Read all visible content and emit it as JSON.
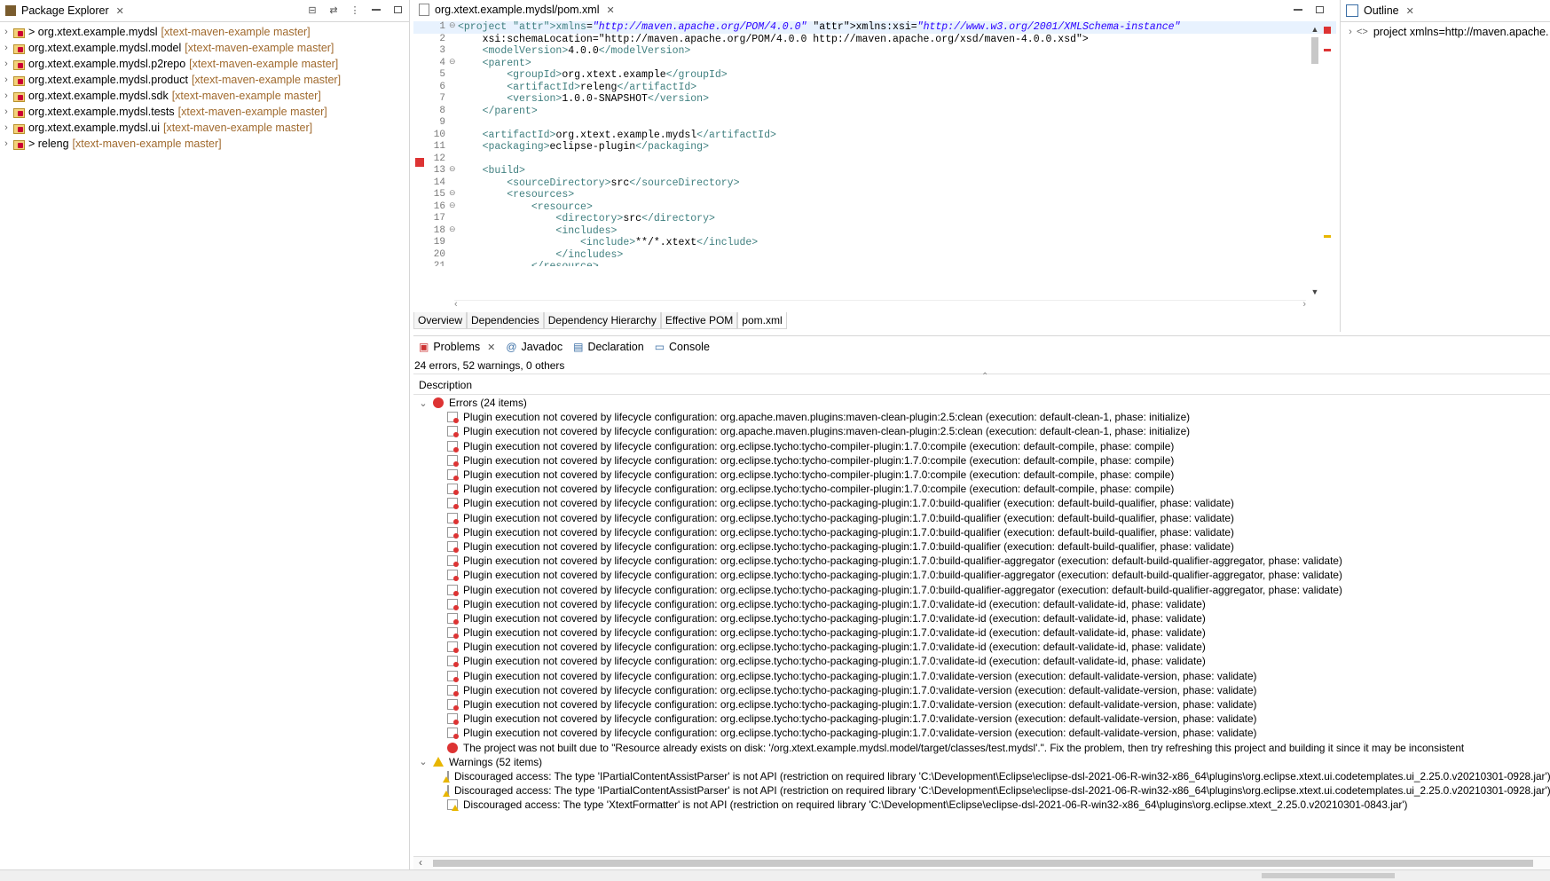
{
  "package_explorer": {
    "title": "Package Explorer",
    "projects": [
      {
        "name": "> org.xtext.example.mydsl",
        "branch": "[xtext-maven-example master]"
      },
      {
        "name": "org.xtext.example.mydsl.model",
        "branch": "[xtext-maven-example master]"
      },
      {
        "name": "org.xtext.example.mydsl.p2repo",
        "branch": "[xtext-maven-example master]"
      },
      {
        "name": "org.xtext.example.mydsl.product",
        "branch": "[xtext-maven-example master]"
      },
      {
        "name": "org.xtext.example.mydsl.sdk",
        "branch": "[xtext-maven-example master]"
      },
      {
        "name": "org.xtext.example.mydsl.tests",
        "branch": "[xtext-maven-example master]"
      },
      {
        "name": "org.xtext.example.mydsl.ui",
        "branch": "[xtext-maven-example master]"
      },
      {
        "name": "> releng",
        "branch": "[xtext-maven-example master]"
      }
    ]
  },
  "editor": {
    "tab_title": "org.xtext.example.mydsl/pom.xml",
    "lines": [
      {
        "n": "1",
        "f": "⊖",
        "c": "<project xmlns=\"http://maven.apache.org/POM/4.0.0\" xmlns:xsi=\"http://www.w3.org/2001/XMLSchema-instance\""
      },
      {
        "n": "2",
        "f": "",
        "c": "    xsi:schemaLocation=\"http://maven.apache.org/POM/4.0.0 http://maven.apache.org/xsd/maven-4.0.0.xsd\">"
      },
      {
        "n": "3",
        "f": "",
        "c": "    <modelVersion>4.0.0</modelVersion>"
      },
      {
        "n": "4",
        "f": "⊖",
        "c": "    <parent>"
      },
      {
        "n": "5",
        "f": "",
        "c": "        <groupId>org.xtext.example</groupId>"
      },
      {
        "n": "6",
        "f": "",
        "c": "        <artifactId>releng</artifactId>"
      },
      {
        "n": "7",
        "f": "",
        "c": "        <version>1.0.0-SNAPSHOT</version>"
      },
      {
        "n": "8",
        "f": "",
        "c": "    </parent>"
      },
      {
        "n": "9",
        "f": "",
        "c": ""
      },
      {
        "n": "10",
        "f": "",
        "c": "    <artifactId>org.xtext.example.mydsl</artifactId>"
      },
      {
        "n": "11",
        "f": "",
        "c": "    <packaging>eclipse-plugin</packaging>"
      },
      {
        "n": "12",
        "f": "",
        "c": ""
      },
      {
        "n": "13",
        "f": "⊖",
        "c": "    <build>"
      },
      {
        "n": "14",
        "f": "",
        "c": "        <sourceDirectory>src</sourceDirectory>"
      },
      {
        "n": "15",
        "f": "⊖",
        "c": "        <resources>"
      },
      {
        "n": "16",
        "f": "⊖",
        "c": "            <resource>"
      },
      {
        "n": "17",
        "f": "",
        "c": "                <directory>src</directory>"
      },
      {
        "n": "18",
        "f": "⊖",
        "c": "                <includes>"
      },
      {
        "n": "19",
        "f": "",
        "c": "                    <include>**/*.xtext</include>"
      },
      {
        "n": "20",
        "f": "",
        "c": "                </includes>"
      },
      {
        "n": "21",
        "f": "",
        "c": "            </resource>"
      }
    ],
    "bottom_tabs": [
      "Overview",
      "Dependencies",
      "Dependency Hierarchy",
      "Effective POM",
      "pom.xml"
    ]
  },
  "outline": {
    "title": "Outline",
    "item": "project xmlns=http://maven.apache."
  },
  "problems": {
    "tabs": [
      "Problems",
      "Javadoc",
      "Declaration",
      "Console"
    ],
    "summary": "24 errors, 52 warnings, 0 others",
    "column": "Description",
    "errors_header": "Errors (24 items)",
    "errors": [
      "Plugin execution not covered by lifecycle configuration: org.apache.maven.plugins:maven-clean-plugin:2.5:clean (execution: default-clean-1, phase: initialize)",
      "Plugin execution not covered by lifecycle configuration: org.apache.maven.plugins:maven-clean-plugin:2.5:clean (execution: default-clean-1, phase: initialize)",
      "Plugin execution not covered by lifecycle configuration: org.eclipse.tycho:tycho-compiler-plugin:1.7.0:compile (execution: default-compile, phase: compile)",
      "Plugin execution not covered by lifecycle configuration: org.eclipse.tycho:tycho-compiler-plugin:1.7.0:compile (execution: default-compile, phase: compile)",
      "Plugin execution not covered by lifecycle configuration: org.eclipse.tycho:tycho-compiler-plugin:1.7.0:compile (execution: default-compile, phase: compile)",
      "Plugin execution not covered by lifecycle configuration: org.eclipse.tycho:tycho-compiler-plugin:1.7.0:compile (execution: default-compile, phase: compile)",
      "Plugin execution not covered by lifecycle configuration: org.eclipse.tycho:tycho-packaging-plugin:1.7.0:build-qualifier (execution: default-build-qualifier, phase: validate)",
      "Plugin execution not covered by lifecycle configuration: org.eclipse.tycho:tycho-packaging-plugin:1.7.0:build-qualifier (execution: default-build-qualifier, phase: validate)",
      "Plugin execution not covered by lifecycle configuration: org.eclipse.tycho:tycho-packaging-plugin:1.7.0:build-qualifier (execution: default-build-qualifier, phase: validate)",
      "Plugin execution not covered by lifecycle configuration: org.eclipse.tycho:tycho-packaging-plugin:1.7.0:build-qualifier (execution: default-build-qualifier, phase: validate)",
      "Plugin execution not covered by lifecycle configuration: org.eclipse.tycho:tycho-packaging-plugin:1.7.0:build-qualifier-aggregator (execution: default-build-qualifier-aggregator, phase: validate)",
      "Plugin execution not covered by lifecycle configuration: org.eclipse.tycho:tycho-packaging-plugin:1.7.0:build-qualifier-aggregator (execution: default-build-qualifier-aggregator, phase: validate)",
      "Plugin execution not covered by lifecycle configuration: org.eclipse.tycho:tycho-packaging-plugin:1.7.0:build-qualifier-aggregator (execution: default-build-qualifier-aggregator, phase: validate)",
      "Plugin execution not covered by lifecycle configuration: org.eclipse.tycho:tycho-packaging-plugin:1.7.0:validate-id (execution: default-validate-id, phase: validate)",
      "Plugin execution not covered by lifecycle configuration: org.eclipse.tycho:tycho-packaging-plugin:1.7.0:validate-id (execution: default-validate-id, phase: validate)",
      "Plugin execution not covered by lifecycle configuration: org.eclipse.tycho:tycho-packaging-plugin:1.7.0:validate-id (execution: default-validate-id, phase: validate)",
      "Plugin execution not covered by lifecycle configuration: org.eclipse.tycho:tycho-packaging-plugin:1.7.0:validate-id (execution: default-validate-id, phase: validate)",
      "Plugin execution not covered by lifecycle configuration: org.eclipse.tycho:tycho-packaging-plugin:1.7.0:validate-id (execution: default-validate-id, phase: validate)",
      "Plugin execution not covered by lifecycle configuration: org.eclipse.tycho:tycho-packaging-plugin:1.7.0:validate-version (execution: default-validate-version, phase: validate)",
      "Plugin execution not covered by lifecycle configuration: org.eclipse.tycho:tycho-packaging-plugin:1.7.0:validate-version (execution: default-validate-version, phase: validate)",
      "Plugin execution not covered by lifecycle configuration: org.eclipse.tycho:tycho-packaging-plugin:1.7.0:validate-version (execution: default-validate-version, phase: validate)",
      "Plugin execution not covered by lifecycle configuration: org.eclipse.tycho:tycho-packaging-plugin:1.7.0:validate-version (execution: default-validate-version, phase: validate)",
      "Plugin execution not covered by lifecycle configuration: org.eclipse.tycho:tycho-packaging-plugin:1.7.0:validate-version (execution: default-validate-version, phase: validate)"
    ],
    "error_last": "The project was not built due to \"Resource already exists on disk: '/org.xtext.example.mydsl.model/target/classes/test.mydsl'.\". Fix the problem, then try refreshing this project and building it since it may be inconsistent",
    "warnings_header": "Warnings (52 items)",
    "warnings": [
      "Discouraged access: The type 'IPartialContentAssistParser' is not API (restriction on required library 'C:\\Development\\Eclipse\\eclipse-dsl-2021-06-R-win32-x86_64\\plugins\\org.eclipse.xtext.ui.codetemplates.ui_2.25.0.v20210301-0928.jar')",
      "Discouraged access: The type 'IPartialContentAssistParser' is not API (restriction on required library 'C:\\Development\\Eclipse\\eclipse-dsl-2021-06-R-win32-x86_64\\plugins\\org.eclipse.xtext.ui.codetemplates.ui_2.25.0.v20210301-0928.jar')",
      "Discouraged access: The type 'XtextFormatter' is not API (restriction on required library 'C:\\Development\\Eclipse\\eclipse-dsl-2021-06-R-win32-x86_64\\plugins\\org.eclipse.xtext_2.25.0.v20210301-0843.jar')"
    ]
  }
}
